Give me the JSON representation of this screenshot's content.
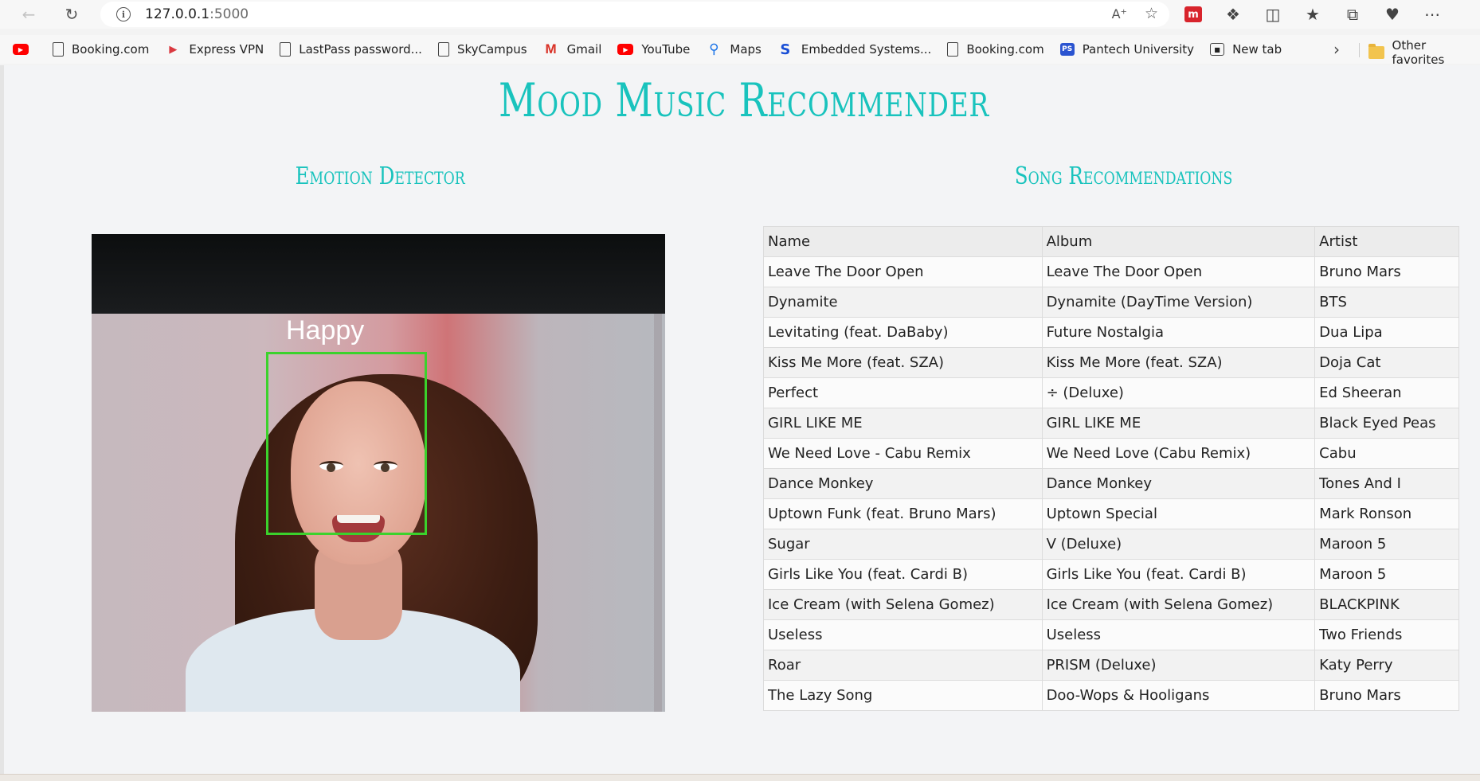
{
  "browser": {
    "url_host": "127.0.0.1",
    "url_port": ":5000",
    "favorites": [
      {
        "label": "",
        "icon": "youtube-icon"
      },
      {
        "label": "Booking.com",
        "icon": "page-icon"
      },
      {
        "label": "Express VPN",
        "icon": "expressvpn-icon"
      },
      {
        "label": "LastPass password...",
        "icon": "page-icon"
      },
      {
        "label": "SkyCampus",
        "icon": "page-icon"
      },
      {
        "label": "Gmail",
        "icon": "gmail-icon"
      },
      {
        "label": "YouTube",
        "icon": "youtube-icon"
      },
      {
        "label": "Maps",
        "icon": "maps-icon"
      },
      {
        "label": "Embedded Systems...",
        "icon": "skyfi-icon"
      },
      {
        "label": "Booking.com",
        "icon": "page-icon"
      },
      {
        "label": "Pantech University",
        "icon": "pantech-icon"
      },
      {
        "label": "New tab",
        "icon": "new-tab-icon"
      }
    ],
    "other_favorites": "Other favorites"
  },
  "app": {
    "title": "Mood Music Recommender",
    "emotion_heading": "Emotion Detector",
    "songs_heading": "Song Recommendations",
    "detected_emotion": "Happy"
  },
  "table": {
    "headers": [
      "Name",
      "Album",
      "Artist"
    ],
    "rows": [
      [
        "Leave The Door Open",
        "Leave The Door Open",
        "Bruno Mars"
      ],
      [
        "Dynamite",
        "Dynamite (DayTime Version)",
        "BTS"
      ],
      [
        "Levitating (feat. DaBaby)",
        "Future Nostalgia",
        "Dua Lipa"
      ],
      [
        "Kiss Me More (feat. SZA)",
        "Kiss Me More (feat. SZA)",
        "Doja Cat"
      ],
      [
        "Perfect",
        "÷ (Deluxe)",
        "Ed Sheeran"
      ],
      [
        "GIRL LIKE ME",
        "GIRL LIKE ME",
        "Black Eyed Peas"
      ],
      [
        "We Need Love - Cabu Remix",
        "We Need Love (Cabu Remix)",
        "Cabu"
      ],
      [
        "Dance Monkey",
        "Dance Monkey",
        "Tones And I"
      ],
      [
        "Uptown Funk (feat. Bruno Mars)",
        "Uptown Special",
        "Mark Ronson"
      ],
      [
        "Sugar",
        "V (Deluxe)",
        "Maroon 5"
      ],
      [
        "Girls Like You (feat. Cardi B)",
        "Girls Like You (feat. Cardi B)",
        "Maroon 5"
      ],
      [
        "Ice Cream (with Selena Gomez)",
        "Ice Cream (with Selena Gomez)",
        "BLACKPINK"
      ],
      [
        "Useless",
        "Useless",
        "Two Friends"
      ],
      [
        "Roar",
        "PRISM (Deluxe)",
        "Katy Perry"
      ],
      [
        "The Lazy Song",
        "Doo-Wops & Hooligans",
        "Bruno Mars"
      ]
    ]
  },
  "colors": {
    "accent": "#19c3bd",
    "detection_box": "#3bd22c"
  }
}
